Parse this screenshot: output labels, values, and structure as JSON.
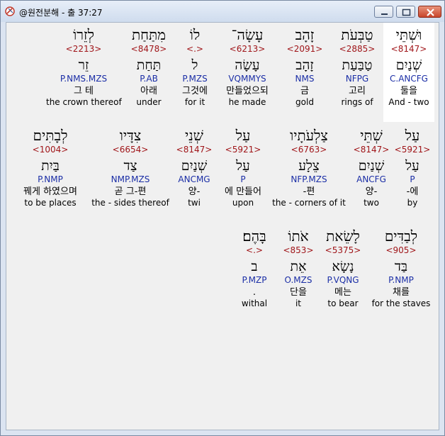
{
  "window": {
    "title": "@원전분해 - 출 37:27"
  },
  "rows": [
    [
      {
        "heb": "וּשְׁתֵּי",
        "num": "<8147>",
        "lemma": "שְׁנַיִם",
        "morph": "C.ANCFG",
        "kor": "둘을",
        "eng": "And - two",
        "selected": true
      },
      {
        "heb": "טַבְּעֹת",
        "num": "<2885>",
        "lemma": "טַבַּעַת",
        "morph": "NFPG",
        "kor": "고리",
        "eng": "rings of"
      },
      {
        "heb": "זָהָב",
        "num": "<2091>",
        "lemma": "זָהָב",
        "morph": "NMS",
        "kor": "금",
        "eng": "gold"
      },
      {
        "heb": "עָשָׂה־",
        "num": "<6213>",
        "lemma": "עָשָׂה",
        "morph": "VQMMYS",
        "kor": "만들었으되",
        "eng": "he made"
      },
      {
        "heb": "לוֹ",
        "num": "<.>",
        "lemma": "ל",
        "morph": "P.MZS",
        "kor": "그것에",
        "eng": "for it"
      },
      {
        "heb": "מִתַּחַת",
        "num": "<8478>",
        "lemma": "תַּחַת",
        "morph": "P.AB",
        "kor": "아래",
        "eng": "under"
      },
      {
        "heb": "לְזֵרוֹ",
        "num": "<2213>",
        "lemma": "זֵר",
        "morph": "P.NMS.MZS",
        "kor": "그 테",
        "eng": "the crown thereof"
      }
    ],
    [
      {
        "heb": "עַל",
        "num": "<5921>",
        "lemma": "עַל",
        "morph": "P",
        "kor": "-에",
        "eng": "by"
      },
      {
        "heb": "שְׁתֵּי",
        "num": "<8147>",
        "lemma": "שְׁנַיִם",
        "morph": "ANCFG",
        "kor": "양-",
        "eng": "two"
      },
      {
        "heb": "צַלְעֹתָיו",
        "num": "<6763>",
        "lemma": "צֵלָע",
        "morph": "NFP.MZS",
        "kor": "-편",
        "eng": "the - corners of it"
      },
      {
        "heb": "עַל",
        "num": "<5921>",
        "lemma": "עַל",
        "morph": "P",
        "kor": "에 만들어",
        "eng": "upon"
      },
      {
        "heb": "שְׁנֵי",
        "num": "<8147>",
        "lemma": "שְׁנַיִם",
        "morph": "ANCMG",
        "kor": "양-",
        "eng": "twi"
      },
      {
        "heb": "צִדָּיו",
        "num": "<6654>",
        "lemma": "צַד",
        "morph": "NMP.MZS",
        "kor": "곧 그-편",
        "eng": "the - sides thereof"
      },
      {
        "heb": "לְבָתִּים",
        "num": "<1004>",
        "lemma": "בַּיִת",
        "morph": "P.NMP",
        "kor": "꿰게 하였으며",
        "eng": "to be places"
      }
    ],
    [
      {
        "heb": "לְבַדִּים",
        "num": "<905>",
        "lemma": "בַּד",
        "morph": "P.NMP",
        "kor": "채를",
        "eng": "for the staves"
      },
      {
        "heb": "לָשֵׂאת",
        "num": "<5375>",
        "lemma": "נָשָׂא",
        "morph": "P.VQNG",
        "kor": "메는",
        "eng": "to bear"
      },
      {
        "heb": "אֹתוֹ",
        "num": "<853>",
        "lemma": "אֵת",
        "morph": "O.MZS",
        "kor": "단을",
        "eng": "it"
      },
      {
        "heb": "בָּהֶם׃",
        "num": "<.>",
        "lemma": "ב",
        "morph": "P.MZP",
        "kor": ".",
        "eng": "withal"
      }
    ]
  ]
}
